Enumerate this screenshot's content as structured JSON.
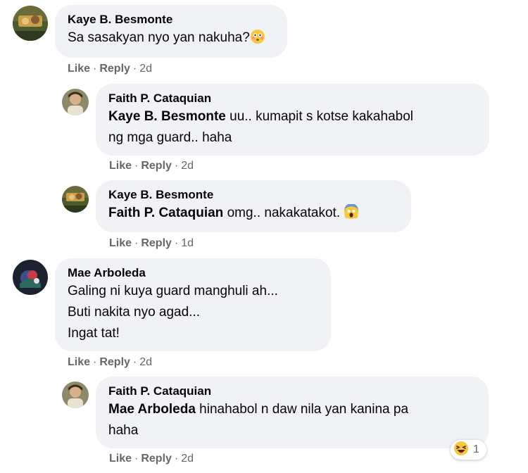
{
  "comments": [
    {
      "author": "Kaye B. Besmonte",
      "mention": "",
      "text": "Sa sasakyan nyo yan nakuha?",
      "emoji": "flushed-face",
      "actions": {
        "like": "Like",
        "reply": "Reply",
        "time": "2d"
      }
    },
    {
      "author": "Faith P. Cataquian",
      "mention": "Kaye B. Besmonte",
      "text": " uu.. kumapit s kotse kakahabol\nng mga guard.. haha",
      "emoji": "",
      "actions": {
        "like": "Like",
        "reply": "Reply",
        "time": "2d"
      }
    },
    {
      "author": "Kaye B. Besmonte",
      "mention": "Faith P. Cataquian",
      "text": " omg.. nakakatakot. ",
      "emoji": "screaming-face",
      "actions": {
        "like": "Like",
        "reply": "Reply",
        "time": "1d"
      }
    },
    {
      "author": "Mae Arboleda",
      "mention": "",
      "text": "Galing ni kuya guard manghuli ah...\nButi nakita nyo agad...\nIngat tat!",
      "emoji": "",
      "actions": {
        "like": "Like",
        "reply": "Reply",
        "time": "2d"
      }
    },
    {
      "author": "Faith P. Cataquian",
      "mention": "Mae Arboleda",
      "text": " hinahabol n daw nila yan kanina pa\nhaha",
      "emoji": "",
      "actions": {
        "like": "Like",
        "reply": "Reply",
        "time": "2d"
      },
      "reaction": {
        "icon": "haha-reaction-icon",
        "count": "1"
      }
    }
  ],
  "colors": {
    "bubble": "#f0f2f5",
    "meta": "#65676b",
    "text": "#050505"
  },
  "separator": "·"
}
